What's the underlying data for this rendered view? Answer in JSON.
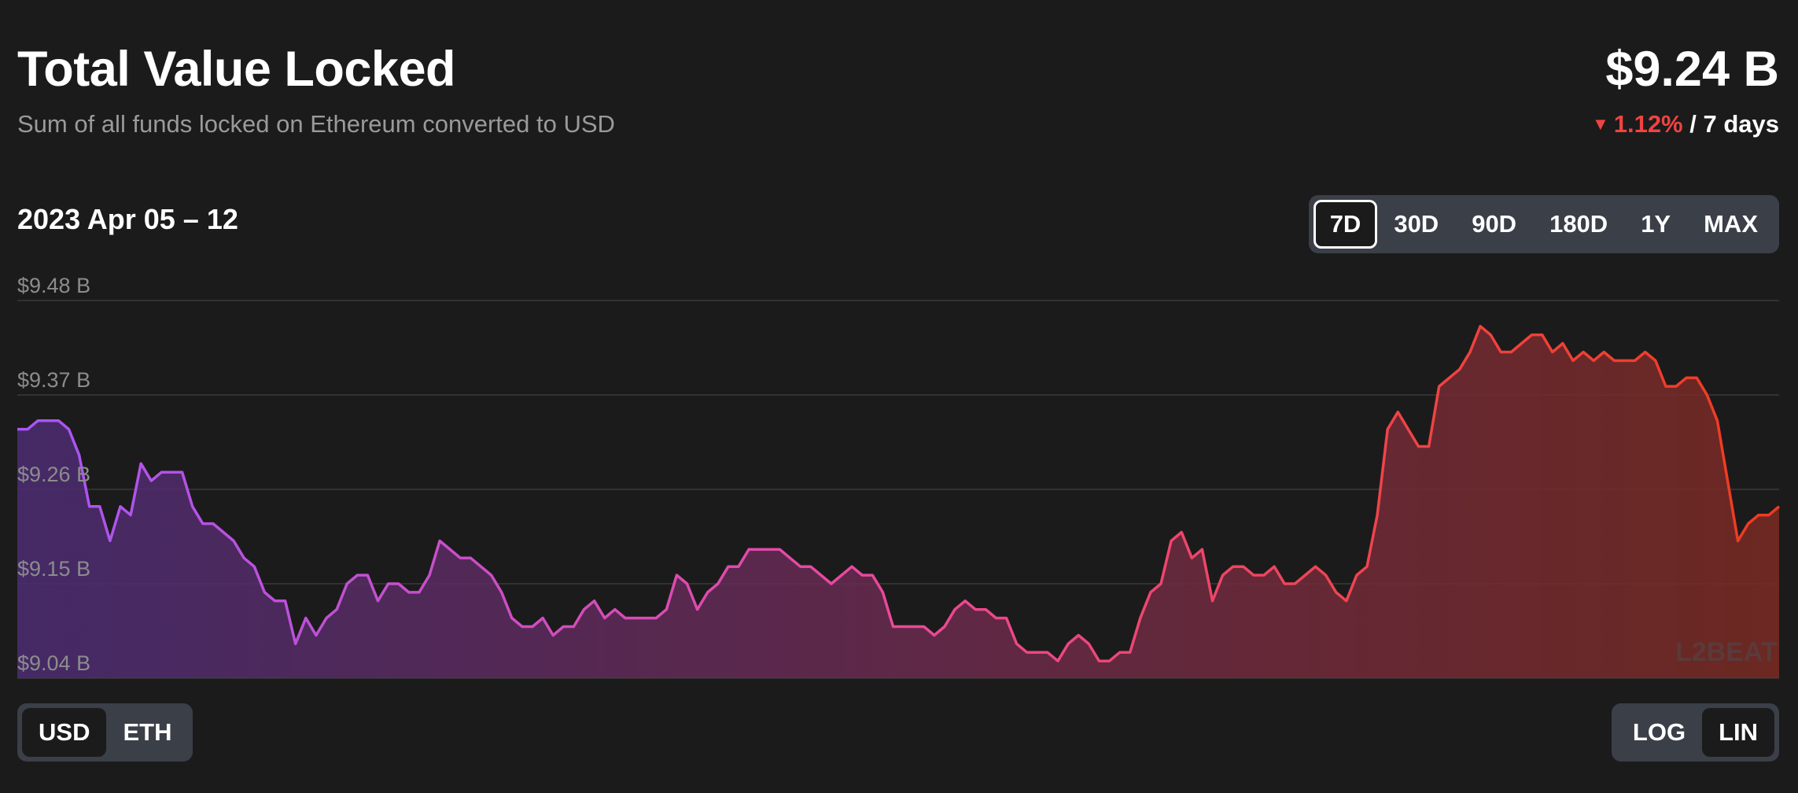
{
  "header": {
    "title": "Total Value Locked",
    "subtitle": "Sum of all funds locked on Ethereum converted to USD",
    "tvl_value": "$9.24 B",
    "change_pct": "1.12%",
    "change_period": "/ 7 days",
    "change_direction": "down"
  },
  "date_range": "2023 Apr 05 – 12",
  "range_options": [
    "7D",
    "30D",
    "90D",
    "180D",
    "1Y",
    "MAX"
  ],
  "range_selected": "7D",
  "unit_options": [
    "USD",
    "ETH"
  ],
  "unit_selected": "USD",
  "scale_options": [
    "LOG",
    "LIN"
  ],
  "scale_selected": "LIN",
  "watermark": "L2BEAT",
  "colors": {
    "background": "#1b1b1b",
    "negative": "#ef4343",
    "gradient_start": "#a855f7",
    "gradient_mid": "#ec4899",
    "gradient_end": "#ef3b1f"
  },
  "chart_data": {
    "type": "area",
    "title": "Total Value Locked",
    "xlabel": "",
    "ylabel": "",
    "y_unit": "USD billions",
    "ylim": [
      9.04,
      9.48
    ],
    "y_ticks": [
      "$9.48 B",
      "$9.37 B",
      "$9.26 B",
      "$9.15 B",
      "$9.04 B"
    ],
    "y_tick_values": [
      9.48,
      9.37,
      9.26,
      9.15,
      9.04
    ],
    "grid": true,
    "x_start": "2023-04-05",
    "x_end": "2023-04-12",
    "values": [
      9.33,
      9.33,
      9.34,
      9.34,
      9.34,
      9.33,
      9.3,
      9.24,
      9.24,
      9.2,
      9.24,
      9.23,
      9.29,
      9.27,
      9.28,
      9.28,
      9.28,
      9.24,
      9.22,
      9.22,
      9.21,
      9.2,
      9.18,
      9.17,
      9.14,
      9.13,
      9.13,
      9.08,
      9.11,
      9.09,
      9.11,
      9.12,
      9.15,
      9.16,
      9.16,
      9.13,
      9.15,
      9.15,
      9.14,
      9.14,
      9.16,
      9.2,
      9.19,
      9.18,
      9.18,
      9.17,
      9.16,
      9.14,
      9.11,
      9.1,
      9.1,
      9.11,
      9.09,
      9.1,
      9.1,
      9.12,
      9.13,
      9.11,
      9.12,
      9.11,
      9.11,
      9.11,
      9.11,
      9.12,
      9.16,
      9.15,
      9.12,
      9.14,
      9.15,
      9.17,
      9.17,
      9.19,
      9.19,
      9.19,
      9.19,
      9.18,
      9.17,
      9.17,
      9.16,
      9.15,
      9.16,
      9.17,
      9.16,
      9.16,
      9.14,
      9.1,
      9.1,
      9.1,
      9.1,
      9.09,
      9.1,
      9.12,
      9.13,
      9.12,
      9.12,
      9.11,
      9.11,
      9.08,
      9.07,
      9.07,
      9.07,
      9.06,
      9.08,
      9.09,
      9.08,
      9.06,
      9.06,
      9.07,
      9.07,
      9.11,
      9.14,
      9.15,
      9.2,
      9.21,
      9.18,
      9.19,
      9.13,
      9.16,
      9.17,
      9.17,
      9.16,
      9.16,
      9.17,
      9.15,
      9.15,
      9.16,
      9.17,
      9.16,
      9.14,
      9.13,
      9.16,
      9.17,
      9.23,
      9.33,
      9.35,
      9.33,
      9.31,
      9.31,
      9.38,
      9.39,
      9.4,
      9.42,
      9.45,
      9.44,
      9.42,
      9.42,
      9.43,
      9.44,
      9.44,
      9.42,
      9.43,
      9.41,
      9.42,
      9.41,
      9.42,
      9.41,
      9.41,
      9.41,
      9.42,
      9.41,
      9.38,
      9.38,
      9.39,
      9.39,
      9.37,
      9.34,
      9.27,
      9.2,
      9.22,
      9.23,
      9.23,
      9.24
    ]
  }
}
